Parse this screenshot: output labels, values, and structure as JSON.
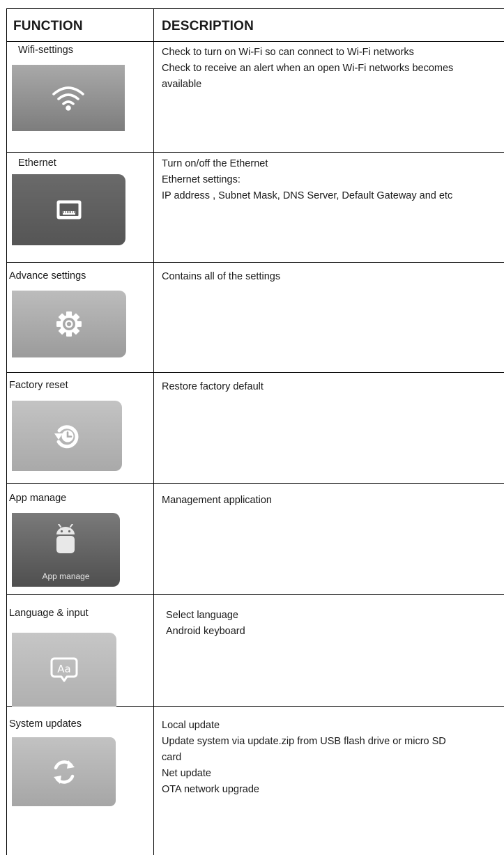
{
  "header": {
    "function_label": "FUNCTION",
    "description_label": "DESCRIPTION"
  },
  "rows": [
    {
      "function": "Wifi-settings",
      "icon": "wifi-icon",
      "description": [
        "Check to turn on Wi-Fi so can connect to Wi-Fi networks",
        "Check to receive an alert when an open Wi-Fi networks becomes",
        "available"
      ]
    },
    {
      "function": "Ethernet",
      "icon": "ethernet-port-icon",
      "description": [
        "Turn on/off the Ethernet",
        "Ethernet settings:",
        "IP address , Subnet Mask, DNS Server, Default Gateway and etc"
      ]
    },
    {
      "function": "Advance settings",
      "icon": "gear-icon",
      "description": [
        "Contains all of the settings"
      ]
    },
    {
      "function": "Factory reset",
      "icon": "restore-clock-icon",
      "description": [
        "Restore factory default"
      ]
    },
    {
      "function": "App manage",
      "icon": "android-icon",
      "tile_caption": "App manage",
      "description": [
        "Management application"
      ]
    },
    {
      "function": "Language & input",
      "icon": "language-aa-icon",
      "description": [
        "Select language",
        "Android keyboard"
      ]
    },
    {
      "function": "System updates",
      "icon": "refresh-icon",
      "description": [
        "Local update",
        "Update system via update.zip from USB flash drive or micro SD",
        "card",
        "Net update",
        "OTA network upgrade"
      ]
    }
  ],
  "colors": {
    "border": "#000000",
    "text": "#1a1a1a",
    "tile_light": "#b5b5b5",
    "tile_dark": "#5f5f5f"
  }
}
